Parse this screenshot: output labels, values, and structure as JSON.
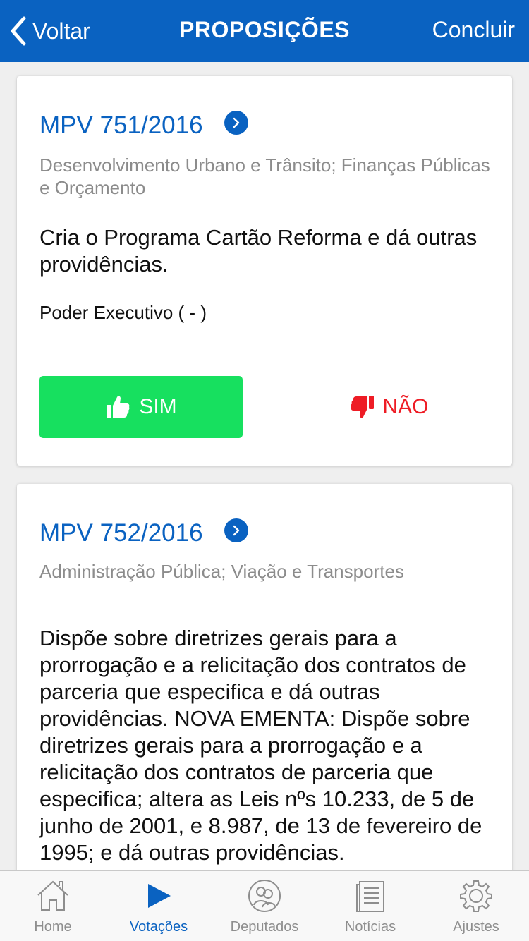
{
  "header": {
    "back_label": "Voltar",
    "title": "PROPOSIÇÕES",
    "done_label": "Concluir"
  },
  "propositions": [
    {
      "title": "MPV 751/2016",
      "themes": "Desenvolvimento Urbano e Trânsito; Finanças Públicas e Orçamento",
      "description": "Cria o Programa Cartão Reforma e dá outras providências.",
      "author": "Poder Executivo ( - )",
      "yes_label": "SIM",
      "no_label": "NÃO"
    },
    {
      "title": "MPV 752/2016",
      "themes": "Administração Pública; Viação e Transportes",
      "description": "Dispõe sobre diretrizes gerais para a prorrogação e a relicitação dos contratos de parceria que especifica e dá outras providências. NOVA EMENTA: Dispõe sobre diretrizes gerais para a prorrogação e a relicitação dos contratos de parceria que especifica; altera as Leis nºs 10.233, de 5 de junho de 2001, e 8.987, de 13 de fevereiro de 1995; e dá outras providências."
    }
  ],
  "tabbar": {
    "items": [
      {
        "label": "Home",
        "icon": "home-icon"
      },
      {
        "label": "Votações",
        "icon": "play-icon",
        "active": true
      },
      {
        "label": "Deputados",
        "icon": "people-icon"
      },
      {
        "label": "Notícias",
        "icon": "news-icon"
      },
      {
        "label": "Ajustes",
        "icon": "gear-icon"
      }
    ]
  },
  "colors": {
    "primary": "#0a62c1",
    "yes": "#17e05f",
    "no": "#ee1c25",
    "muted": "#8c8c8c"
  }
}
